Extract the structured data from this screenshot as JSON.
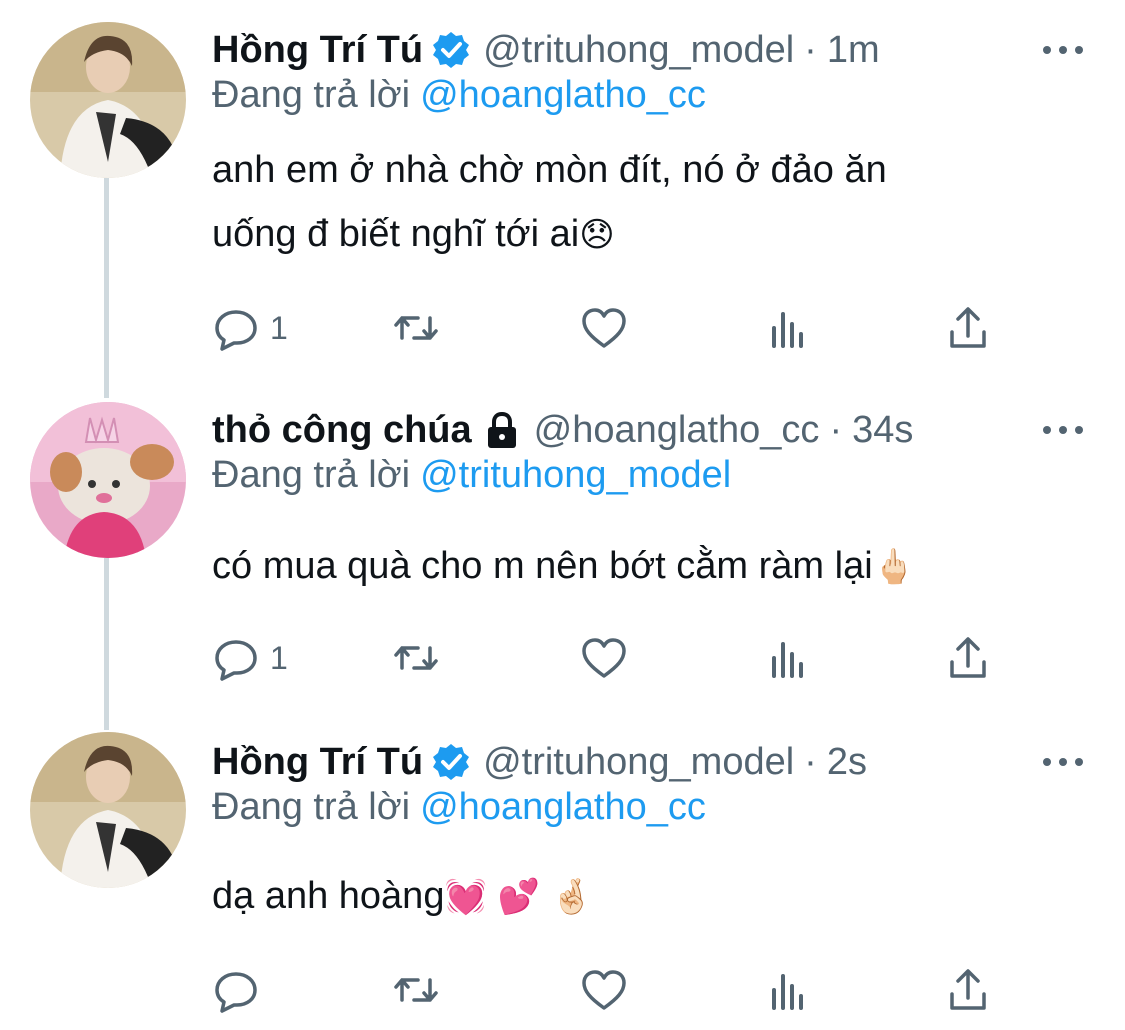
{
  "tweets": [
    {
      "name": "Hồng Trí Tú",
      "verified": true,
      "handle": "@trituhong_model",
      "separator": "·",
      "time": "1m",
      "replying_label": "Đang trả lời",
      "replying_to": "@hoanglatho_cc",
      "text_line1": "anh em ở nhà chờ mòn đít, nó ở đảo ăn",
      "text_line2": "uống đ biết nghĩ tới ai",
      "emoji": "😞",
      "reply_count": "1"
    },
    {
      "name": "thỏ công chúa",
      "locked": true,
      "handle": "@hoanglatho_cc",
      "separator": "·",
      "time": "34s",
      "replying_label": "Đang trả lời",
      "replying_to": "@trituhong_model",
      "text_line1": "có mua quà cho m nên bớt cằm ràm lại",
      "emoji": "🖕🏻",
      "reply_count": "1"
    },
    {
      "name": "Hồng Trí Tú",
      "verified": true,
      "handle": "@trituhong_model",
      "separator": "·",
      "time": "2s",
      "replying_label": "Đang trả lời",
      "replying_to": "@hoanglatho_cc",
      "text_line1": "dạ anh hoàng",
      "emoji": "💓 💕 🤞🏻",
      "reply_count": ""
    }
  ],
  "colors": {
    "verified_blue": "#1d9bf0",
    "secondary_text": "#536471",
    "thread_line": "#cfd9de"
  },
  "icons": [
    "reply-icon",
    "retweet-icon",
    "like-icon",
    "views-icon",
    "share-icon",
    "more-icon",
    "verified-badge-icon",
    "lock-icon"
  ]
}
